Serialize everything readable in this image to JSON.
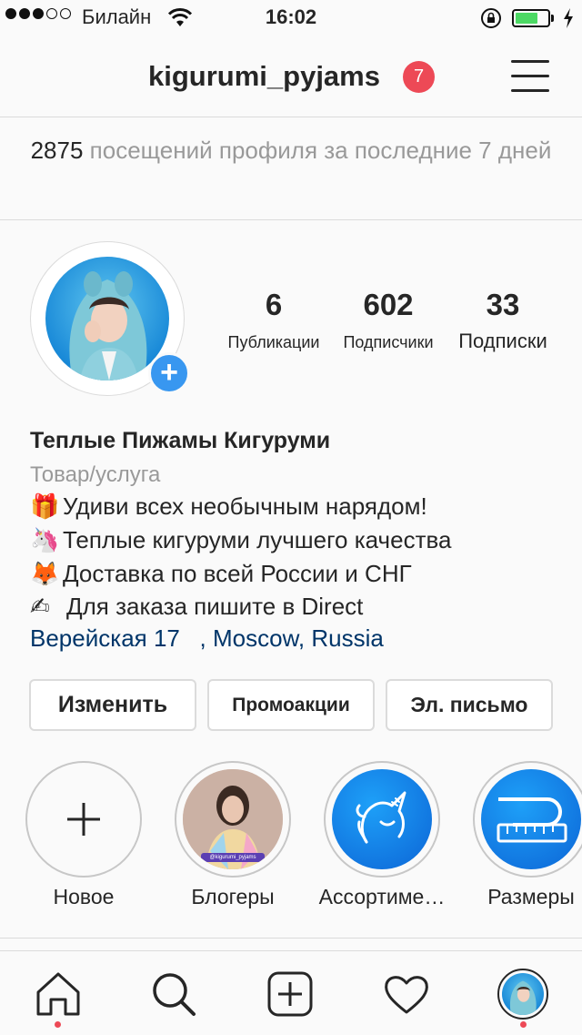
{
  "status_bar": {
    "carrier": "Билайн",
    "time": "16:02",
    "battery_level": 0.7,
    "battery_color": "#4cd964"
  },
  "header": {
    "username": "kigurumi_pyjams",
    "notification_count": "7",
    "menu_icon": "hamburger-icon"
  },
  "profile_visits": {
    "count": "2875",
    "text": "посещений профиля за последние 7 дней"
  },
  "stats": [
    {
      "value": "6",
      "label": "Публикации"
    },
    {
      "value": "602",
      "label": "Подписчики"
    },
    {
      "value": "33",
      "label": "Подписки"
    }
  ],
  "bio": {
    "name": "Теплые Пижамы Кигуруми",
    "category": "Товар/услуга",
    "lines": [
      {
        "emoji": "🎁",
        "text": "Удиви всех необычным нарядом!"
      },
      {
        "emoji": "🦄",
        "text": "Теплые кигуруми лучшего качества"
      },
      {
        "emoji": "🦊",
        "text": "Доставка по всей России и СНГ"
      },
      {
        "emoji": "✍",
        "text": "Для заказа пишите в Direct"
      }
    ],
    "location": "Верейская 17   , Moscow, Russia"
  },
  "buttons": {
    "edit": "Изменить",
    "promotions": "Промоакции",
    "email": "Эл. письмо"
  },
  "highlights": [
    {
      "label": "Новое",
      "icon": "plus-icon"
    },
    {
      "label": "Блогеры",
      "icon": "photo",
      "caption": "@kigurumi_pyjams"
    },
    {
      "label": "Ассортиме…",
      "icon": "unicorn-icon"
    },
    {
      "label": "Размеры",
      "icon": "measuring-tape-icon"
    }
  ],
  "tab_bar": [
    "home-icon",
    "search-icon",
    "add-post-icon",
    "activity-heart-icon",
    "profile-avatar"
  ],
  "colors": {
    "accent_blue": "#3897f0",
    "notification_red": "#ed4956",
    "location_link": "#003569",
    "highlight_gradient_start": "#1ea0f8",
    "highlight_gradient_end": "#0c65d6"
  }
}
